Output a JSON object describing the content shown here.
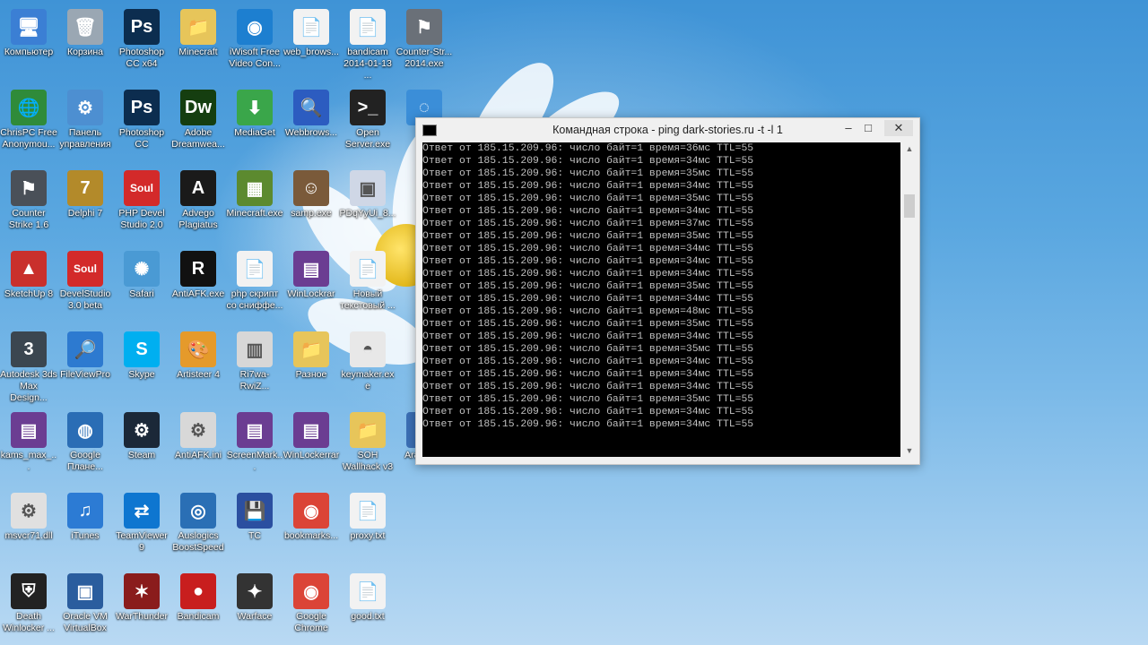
{
  "desktop": {
    "icons": [
      {
        "label": "Компьютер",
        "glyph": "🖥",
        "color": "#3b7fd4"
      },
      {
        "label": "Корзина",
        "glyph": "🗑",
        "color": "#9aa7b3"
      },
      {
        "label": "Photoshop CC x64",
        "glyph": "Ps",
        "color": "#0c2d4f"
      },
      {
        "label": "Minecraft",
        "glyph": "📁",
        "color": "#e7c55a"
      },
      {
        "label": "iWisoft Free Video Con...",
        "glyph": "◉",
        "color": "#1d7fd0"
      },
      {
        "label": "web_brows...",
        "glyph": "📄",
        "color": "#f2f2f2"
      },
      {
        "label": "bandicam 2014-01-13 ...",
        "glyph": "📄",
        "color": "#f2f2f2"
      },
      {
        "label": "Counter-Str... 2014.exe",
        "glyph": "⚑",
        "color": "#6a7078"
      },
      {
        "label": "ChrisPC Free Anonymou...",
        "glyph": "🌐",
        "color": "#2f8b3a"
      },
      {
        "label": "Панель управления",
        "glyph": "⚙",
        "color": "#4d8fd1"
      },
      {
        "label": "Photoshop CC",
        "glyph": "Ps",
        "color": "#0c2d4f"
      },
      {
        "label": "Adobe Dreamwea...",
        "glyph": "Dw",
        "color": "#153e10"
      },
      {
        "label": "MediaGet",
        "glyph": "⬇",
        "color": "#3aa64a"
      },
      {
        "label": "Webbrows...",
        "glyph": "🔍",
        "color": "#2c5cc0"
      },
      {
        "label": "Open Server.exe",
        "glyph": ">_",
        "color": "#222"
      },
      {
        "label": "",
        "glyph": "◌",
        "color": "#3b8ed8"
      },
      {
        "label": "Counter Strike 1.6",
        "glyph": "⚑",
        "color": "#4a5058"
      },
      {
        "label": "Delphi 7",
        "glyph": "7",
        "color": "#b38a2a"
      },
      {
        "label": "PHP Devel Studio 2.0",
        "glyph": "Soul",
        "color": "#d32a2a"
      },
      {
        "label": "Advego Plagiatus",
        "glyph": "A",
        "color": "#1a1a1a"
      },
      {
        "label": "Minecraft.exe",
        "glyph": "▦",
        "color": "#5c8a2f"
      },
      {
        "label": "samp.exe",
        "glyph": "☺",
        "color": "#7a5a3a"
      },
      {
        "label": "PDqYyUi_8...",
        "glyph": "▣",
        "color": "#cfd7e6"
      },
      {
        "label": "SketchUp 8",
        "glyph": "▲",
        "color": "#c9302c"
      },
      {
        "label": "DevelStudio 3.0 beta",
        "glyph": "Soul",
        "color": "#d32a2a"
      },
      {
        "label": "Safari",
        "glyph": "✺",
        "color": "#4a9ad4"
      },
      {
        "label": "AntiAFK.exe",
        "glyph": "R",
        "color": "#111"
      },
      {
        "label": "php скрипт со сниффе...",
        "glyph": "📄",
        "color": "#f2f2f2"
      },
      {
        "label": "WinLockrar",
        "glyph": "▤",
        "color": "#6b3d92"
      },
      {
        "label": "Новый текстовый ...",
        "glyph": "📄",
        "color": "#f2f2f2"
      },
      {
        "label": "Autodesk 3ds Max Design...",
        "glyph": "3",
        "color": "#3b4650"
      },
      {
        "label": "FileViewPro",
        "glyph": "🔎",
        "color": "#2d7ad0"
      },
      {
        "label": "Skype",
        "glyph": "S",
        "color": "#00aff0"
      },
      {
        "label": "Artisteer 4",
        "glyph": "🎨",
        "color": "#e59a2b"
      },
      {
        "label": "Ri7wa-RwiZ...",
        "glyph": "▥",
        "color": "#d7d7d7"
      },
      {
        "label": "Разное",
        "glyph": "📁",
        "color": "#e7c55a"
      },
      {
        "label": "keymaker.exe",
        "glyph": "◓",
        "color": "#e8e8e8"
      },
      {
        "label": "kams_max_...",
        "glyph": "▤",
        "color": "#6b3d92"
      },
      {
        "label": "Google Плане...",
        "glyph": "◍",
        "color": "#2a6db5"
      },
      {
        "label": "Steam",
        "glyph": "⚙",
        "color": "#1b2838"
      },
      {
        "label": "AntiAFK.ini",
        "glyph": "⚙",
        "color": "#d8d8d8"
      },
      {
        "label": "ScreenMark...",
        "glyph": "▤",
        "color": "#6b3d92"
      },
      {
        "label": "WinLockerrar",
        "glyph": "▤",
        "color": "#6b3d92"
      },
      {
        "label": "SOH Wallhack v3",
        "glyph": "📁",
        "color": "#e7c55a"
      },
      {
        "label": "Araka.avi",
        "glyph": "▶",
        "color": "#3b6fb5"
      },
      {
        "label": "msvcr71.dll",
        "glyph": "⚙",
        "color": "#e0e0e0"
      },
      {
        "label": "iTunes",
        "glyph": "♫",
        "color": "#2c7bd4"
      },
      {
        "label": "TeamViewer 9",
        "glyph": "⇄",
        "color": "#0e76d0"
      },
      {
        "label": "Auslogics BoostSpeed",
        "glyph": "◎",
        "color": "#2a6fb5"
      },
      {
        "label": "TC",
        "glyph": "💾",
        "color": "#2b4fa0"
      },
      {
        "label": "bookmarks...",
        "glyph": "◉",
        "color": "#db4437"
      },
      {
        "label": "proxy.txt",
        "glyph": "📄",
        "color": "#f2f2f2"
      },
      {
        "label": "Death Winlocker ...",
        "glyph": "⛨",
        "color": "#222"
      },
      {
        "label": "Oracle VM VirtualBox",
        "glyph": "▣",
        "color": "#2a5d9e"
      },
      {
        "label": "WarThunder",
        "glyph": "✶",
        "color": "#8a1c1c"
      },
      {
        "label": "Bandicam",
        "glyph": "●",
        "color": "#c81e1e"
      },
      {
        "label": "Warface",
        "glyph": "✦",
        "color": "#333"
      },
      {
        "label": "Google Chrome",
        "glyph": "◉",
        "color": "#db4437"
      },
      {
        "label": "good.txt",
        "glyph": "📄",
        "color": "#f2f2f2"
      }
    ]
  },
  "cmd_window": {
    "title": "Командная строка - ping  dark-stories.ru -t -l 1",
    "minimize": "–",
    "maximize": "□",
    "close": "✕",
    "lines": [
      "Ответ от 185.15.209.96: число байт=1 время=36мс TTL=55",
      "Ответ от 185.15.209.96: число байт=1 время=34мс TTL=55",
      "Ответ от 185.15.209.96: число байт=1 время=35мс TTL=55",
      "Ответ от 185.15.209.96: число байт=1 время=34мс TTL=55",
      "Ответ от 185.15.209.96: число байт=1 время=35мс TTL=55",
      "Ответ от 185.15.209.96: число байт=1 время=34мс TTL=55",
      "Ответ от 185.15.209.96: число байт=1 время=37мс TTL=55",
      "Ответ от 185.15.209.96: число байт=1 время=35мс TTL=55",
      "Ответ от 185.15.209.96: число байт=1 время=34мс TTL=55",
      "Ответ от 185.15.209.96: число байт=1 время=34мс TTL=55",
      "Ответ от 185.15.209.96: число байт=1 время=34мс TTL=55",
      "Ответ от 185.15.209.96: число байт=1 время=35мс TTL=55",
      "Ответ от 185.15.209.96: число байт=1 время=34мс TTL=55",
      "Ответ от 185.15.209.96: число байт=1 время=48мс TTL=55",
      "Ответ от 185.15.209.96: число байт=1 время=35мс TTL=55",
      "Ответ от 185.15.209.96: число байт=1 время=34мс TTL=55",
      "Ответ от 185.15.209.96: число байт=1 время=35мс TTL=55",
      "Ответ от 185.15.209.96: число байт=1 время=34мс TTL=55",
      "Ответ от 185.15.209.96: число байт=1 время=34мс TTL=55",
      "Ответ от 185.15.209.96: число байт=1 время=34мс TTL=55",
      "Ответ от 185.15.209.96: число байт=1 время=35мс TTL=55",
      "Ответ от 185.15.209.96: число байт=1 время=34мс TTL=55",
      "Ответ от 185.15.209.96: число байт=1 время=34мс TTL=55"
    ]
  }
}
